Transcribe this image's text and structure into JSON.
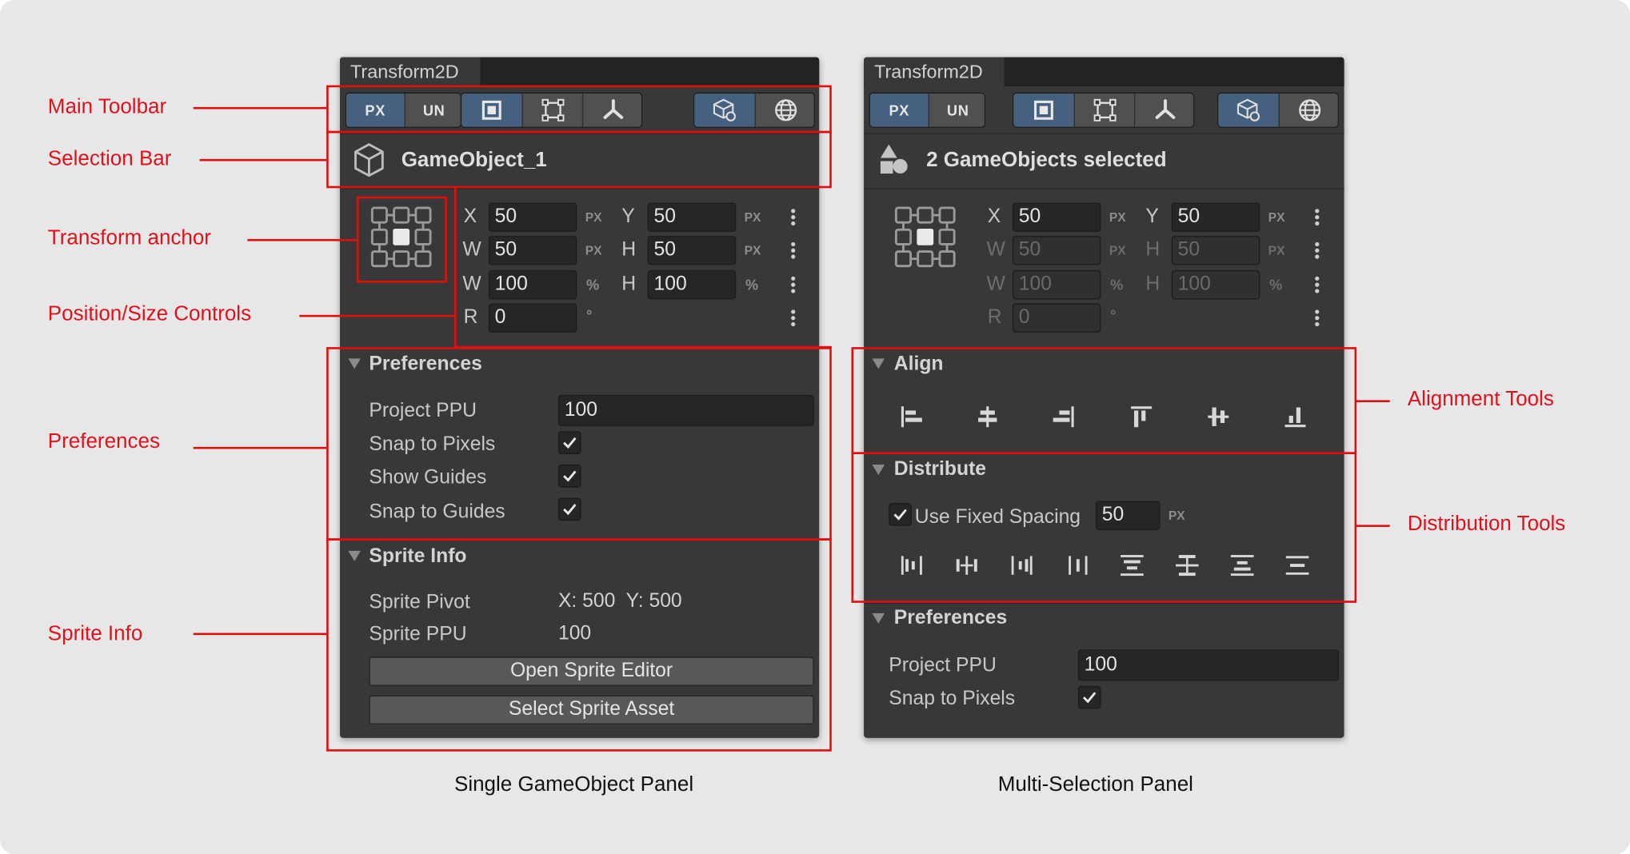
{
  "panels": {
    "single": {
      "tab_title": "Transform2D",
      "toolbar": {
        "px": "PX",
        "un": "UN"
      },
      "object_name": "GameObject_1",
      "fields": {
        "x_label": "X",
        "x_value": "50",
        "x_unit": "PX",
        "y_label": "Y",
        "y_value": "50",
        "y_unit": "PX",
        "w_label": "W",
        "w_value": "50",
        "w_unit": "PX",
        "h_label": "H",
        "h_value": "50",
        "h_unit": "PX",
        "w2_label": "W",
        "w2_value": "100",
        "w2_unit": "%",
        "h2_label": "H",
        "h2_value": "100",
        "h2_unit": "%",
        "r_label": "R",
        "r_value": "0",
        "r_unit": "°"
      },
      "preferences": {
        "title": "Preferences",
        "project_ppu_label": "Project PPU",
        "project_ppu_value": "100",
        "snap_pixels_label": "Snap to Pixels",
        "show_guides_label": "Show Guides",
        "snap_guides_label": "Snap to Guides"
      },
      "sprite_info": {
        "title": "Sprite Info",
        "pivot_label": "Sprite Pivot",
        "pivot_value": "X: 500  Y: 500",
        "ppu_label": "Sprite PPU",
        "ppu_value": "100",
        "open_editor": "Open Sprite Editor",
        "select_asset": "Select Sprite Asset"
      },
      "caption": "Single GameObject Panel"
    },
    "multi": {
      "tab_title": "Transform2D",
      "toolbar": {
        "px": "PX",
        "un": "UN"
      },
      "selection_text": "2 GameObjects selected",
      "fields": {
        "x_label": "X",
        "x_value": "50",
        "x_unit": "PX",
        "y_label": "Y",
        "y_value": "50",
        "y_unit": "PX",
        "w_label": "W",
        "w_value": "50",
        "w_unit": "PX",
        "h_label": "H",
        "h_value": "50",
        "h_unit": "PX",
        "w2_label": "W",
        "w2_value": "100",
        "w2_unit": "%",
        "h2_label": "H",
        "h2_value": "100",
        "h2_unit": "%",
        "r_label": "R",
        "r_value": "0",
        "r_unit": "°"
      },
      "align": {
        "title": "Align"
      },
      "distribute": {
        "title": "Distribute",
        "fixed_label": "Use Fixed Spacing",
        "fixed_value": "50",
        "fixed_unit": "PX"
      },
      "preferences": {
        "title": "Preferences",
        "project_ppu_label": "Project PPU",
        "project_ppu_value": "100",
        "snap_pixels_label": "Snap to Pixels"
      },
      "caption": "Multi-Selection Panel"
    }
  },
  "annotations": {
    "main_toolbar": "Main Toolbar",
    "selection_bar": "Selection Bar",
    "transform_anchor": "Transform anchor",
    "position_size": "Position/Size Controls",
    "preferences": "Preferences",
    "sprite_info": "Sprite Info",
    "alignment_tools": "Alignment Tools",
    "distribution_tools": "Distribution Tools"
  },
  "colors": {
    "annotation_red": "#e10e0e",
    "panel_bg": "#383838",
    "toggle_active": "#46607f"
  }
}
